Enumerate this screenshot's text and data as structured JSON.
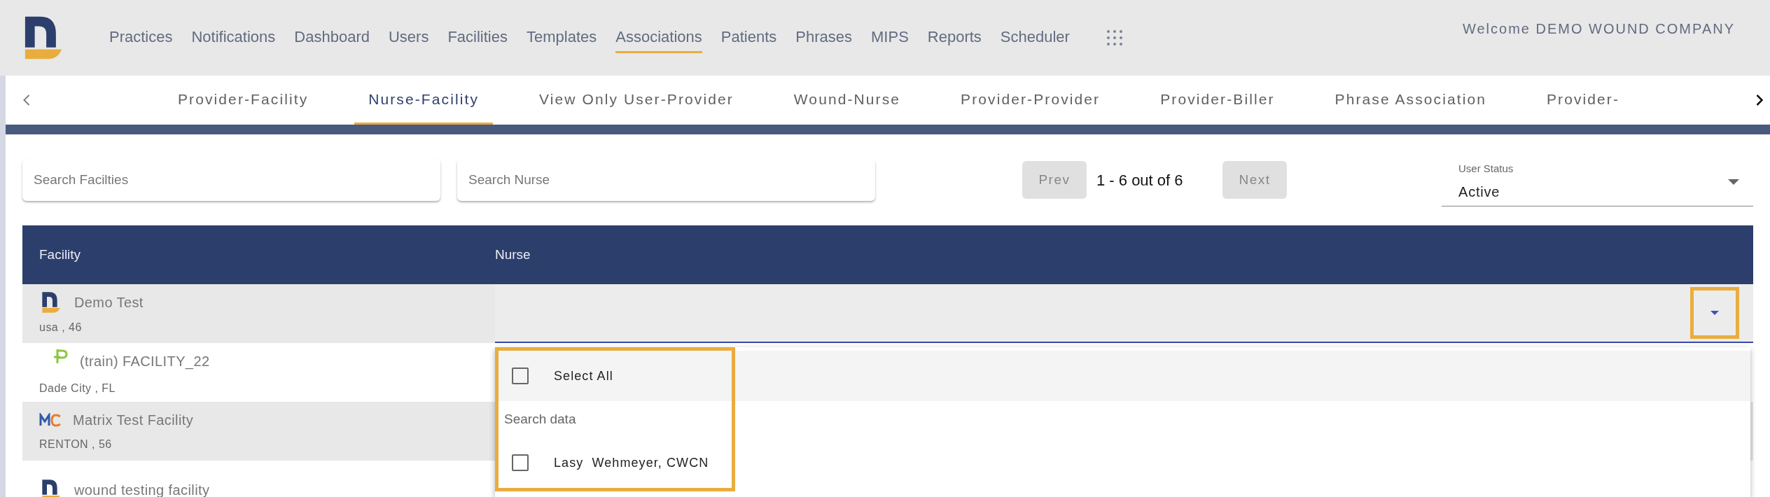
{
  "nav": {
    "items": [
      {
        "label": "Practices",
        "selected": false
      },
      {
        "label": "Notifications",
        "selected": false
      },
      {
        "label": "Dashboard",
        "selected": false
      },
      {
        "label": "Users",
        "selected": false
      },
      {
        "label": "Facilities",
        "selected": false
      },
      {
        "label": "Templates",
        "selected": false
      },
      {
        "label": "Associations",
        "selected": true
      },
      {
        "label": "Patients",
        "selected": false
      },
      {
        "label": "Phrases",
        "selected": false
      },
      {
        "label": "MIPS",
        "selected": false
      },
      {
        "label": "Reports",
        "selected": false
      },
      {
        "label": "Scheduler",
        "selected": false
      }
    ],
    "welcome": "Welcome DEMO WOUND COMPANY"
  },
  "tabs": [
    {
      "label": "Provider-Facility",
      "selected": false
    },
    {
      "label": "Nurse-Facility",
      "selected": true
    },
    {
      "label": "View Only User-Provider",
      "selected": false
    },
    {
      "label": "Wound-Nurse",
      "selected": false
    },
    {
      "label": "Provider-Provider",
      "selected": false
    },
    {
      "label": "Provider-Biller",
      "selected": false
    },
    {
      "label": "Phrase Association",
      "selected": false
    },
    {
      "label": "Provider-",
      "selected": false
    }
  ],
  "filters": {
    "search_facilities": {
      "placeholder": "Search Facilties"
    },
    "search_nurse": {
      "placeholder": "Search Nurse"
    },
    "pagination": {
      "prev": "Prev",
      "range": "1 - 6 out of 6",
      "next": "Next"
    },
    "user_status": {
      "label": "User Status",
      "value": "Active"
    }
  },
  "table": {
    "columns": [
      "Facility",
      "Nurse"
    ],
    "rows": [
      {
        "kind": "d",
        "name": "Demo Test",
        "location": "usa , 46"
      },
      {
        "kind": "p",
        "name": "(train) FACILITY_22",
        "location": "Dade City , FL"
      },
      {
        "kind": "mc",
        "name": "Matrix Test Facility",
        "location": "RENTON , 56"
      },
      {
        "kind": "d",
        "name": "wound testing facility"
      }
    ]
  },
  "nurse_select": {
    "expanded": true,
    "search_placeholder": "Search data",
    "options": [
      {
        "kind": "select_all",
        "label": "Select All",
        "checked": false
      },
      {
        "kind": "item",
        "label": "Lasy  Wehmeyer, CWCN",
        "checked": false
      }
    ]
  }
}
